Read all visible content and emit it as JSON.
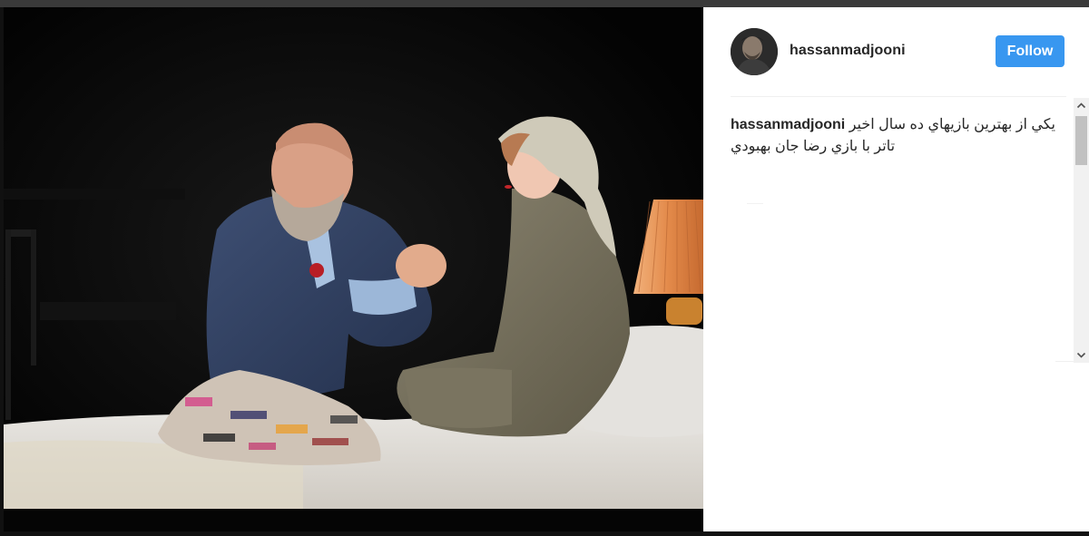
{
  "post": {
    "username": "hassanmadjooni",
    "follow_label": "Follow",
    "caption_user": "hassanmadjooni",
    "caption_text": "يكي از بهترين بازيهاي ده سال اخير تاتر با بازي رضا جان بهبودي",
    "avatar_icon": "user-avatar",
    "photo_icon": "theatre-stage-photo"
  },
  "colors": {
    "follow_button": "#3897f0",
    "username_text": "#262626",
    "divider": "#efefef",
    "scroll_thumb": "#c1c1c1"
  },
  "scrollbar": {
    "up_icon": "chevron-up-icon",
    "down_icon": "chevron-down-icon"
  }
}
